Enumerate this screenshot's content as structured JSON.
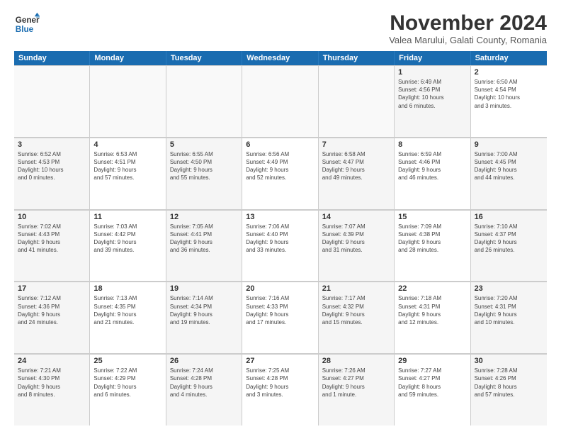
{
  "logo": {
    "line1": "General",
    "line2": "Blue"
  },
  "title": "November 2024",
  "location": "Valea Marului, Galati County, Romania",
  "headers": [
    "Sunday",
    "Monday",
    "Tuesday",
    "Wednesday",
    "Thursday",
    "Friday",
    "Saturday"
  ],
  "weeks": [
    [
      {
        "day": "",
        "info": "",
        "empty": true
      },
      {
        "day": "",
        "info": "",
        "empty": true
      },
      {
        "day": "",
        "info": "",
        "empty": true
      },
      {
        "day": "",
        "info": "",
        "empty": true
      },
      {
        "day": "",
        "info": "",
        "empty": true
      },
      {
        "day": "1",
        "info": "Sunrise: 6:49 AM\nSunset: 4:56 PM\nDaylight: 10 hours\nand 6 minutes.",
        "shaded": true
      },
      {
        "day": "2",
        "info": "Sunrise: 6:50 AM\nSunset: 4:54 PM\nDaylight: 10 hours\nand 3 minutes.",
        "shaded": false
      }
    ],
    [
      {
        "day": "3",
        "info": "Sunrise: 6:52 AM\nSunset: 4:53 PM\nDaylight: 10 hours\nand 0 minutes.",
        "shaded": true
      },
      {
        "day": "4",
        "info": "Sunrise: 6:53 AM\nSunset: 4:51 PM\nDaylight: 9 hours\nand 57 minutes.",
        "shaded": false
      },
      {
        "day": "5",
        "info": "Sunrise: 6:55 AM\nSunset: 4:50 PM\nDaylight: 9 hours\nand 55 minutes.",
        "shaded": true
      },
      {
        "day": "6",
        "info": "Sunrise: 6:56 AM\nSunset: 4:49 PM\nDaylight: 9 hours\nand 52 minutes.",
        "shaded": false
      },
      {
        "day": "7",
        "info": "Sunrise: 6:58 AM\nSunset: 4:47 PM\nDaylight: 9 hours\nand 49 minutes.",
        "shaded": true
      },
      {
        "day": "8",
        "info": "Sunrise: 6:59 AM\nSunset: 4:46 PM\nDaylight: 9 hours\nand 46 minutes.",
        "shaded": false
      },
      {
        "day": "9",
        "info": "Sunrise: 7:00 AM\nSunset: 4:45 PM\nDaylight: 9 hours\nand 44 minutes.",
        "shaded": true
      }
    ],
    [
      {
        "day": "10",
        "info": "Sunrise: 7:02 AM\nSunset: 4:43 PM\nDaylight: 9 hours\nand 41 minutes.",
        "shaded": true
      },
      {
        "day": "11",
        "info": "Sunrise: 7:03 AM\nSunset: 4:42 PM\nDaylight: 9 hours\nand 39 minutes.",
        "shaded": false
      },
      {
        "day": "12",
        "info": "Sunrise: 7:05 AM\nSunset: 4:41 PM\nDaylight: 9 hours\nand 36 minutes.",
        "shaded": true
      },
      {
        "day": "13",
        "info": "Sunrise: 7:06 AM\nSunset: 4:40 PM\nDaylight: 9 hours\nand 33 minutes.",
        "shaded": false
      },
      {
        "day": "14",
        "info": "Sunrise: 7:07 AM\nSunset: 4:39 PM\nDaylight: 9 hours\nand 31 minutes.",
        "shaded": true
      },
      {
        "day": "15",
        "info": "Sunrise: 7:09 AM\nSunset: 4:38 PM\nDaylight: 9 hours\nand 28 minutes.",
        "shaded": false
      },
      {
        "day": "16",
        "info": "Sunrise: 7:10 AM\nSunset: 4:37 PM\nDaylight: 9 hours\nand 26 minutes.",
        "shaded": true
      }
    ],
    [
      {
        "day": "17",
        "info": "Sunrise: 7:12 AM\nSunset: 4:36 PM\nDaylight: 9 hours\nand 24 minutes.",
        "shaded": true
      },
      {
        "day": "18",
        "info": "Sunrise: 7:13 AM\nSunset: 4:35 PM\nDaylight: 9 hours\nand 21 minutes.",
        "shaded": false
      },
      {
        "day": "19",
        "info": "Sunrise: 7:14 AM\nSunset: 4:34 PM\nDaylight: 9 hours\nand 19 minutes.",
        "shaded": true
      },
      {
        "day": "20",
        "info": "Sunrise: 7:16 AM\nSunset: 4:33 PM\nDaylight: 9 hours\nand 17 minutes.",
        "shaded": false
      },
      {
        "day": "21",
        "info": "Sunrise: 7:17 AM\nSunset: 4:32 PM\nDaylight: 9 hours\nand 15 minutes.",
        "shaded": true
      },
      {
        "day": "22",
        "info": "Sunrise: 7:18 AM\nSunset: 4:31 PM\nDaylight: 9 hours\nand 12 minutes.",
        "shaded": false
      },
      {
        "day": "23",
        "info": "Sunrise: 7:20 AM\nSunset: 4:31 PM\nDaylight: 9 hours\nand 10 minutes.",
        "shaded": true
      }
    ],
    [
      {
        "day": "24",
        "info": "Sunrise: 7:21 AM\nSunset: 4:30 PM\nDaylight: 9 hours\nand 8 minutes.",
        "shaded": true
      },
      {
        "day": "25",
        "info": "Sunrise: 7:22 AM\nSunset: 4:29 PM\nDaylight: 9 hours\nand 6 minutes.",
        "shaded": false
      },
      {
        "day": "26",
        "info": "Sunrise: 7:24 AM\nSunset: 4:28 PM\nDaylight: 9 hours\nand 4 minutes.",
        "shaded": true
      },
      {
        "day": "27",
        "info": "Sunrise: 7:25 AM\nSunset: 4:28 PM\nDaylight: 9 hours\nand 3 minutes.",
        "shaded": false
      },
      {
        "day": "28",
        "info": "Sunrise: 7:26 AM\nSunset: 4:27 PM\nDaylight: 9 hours\nand 1 minute.",
        "shaded": true
      },
      {
        "day": "29",
        "info": "Sunrise: 7:27 AM\nSunset: 4:27 PM\nDaylight: 8 hours\nand 59 minutes.",
        "shaded": false
      },
      {
        "day": "30",
        "info": "Sunrise: 7:28 AM\nSunset: 4:26 PM\nDaylight: 8 hours\nand 57 minutes.",
        "shaded": true
      }
    ]
  ]
}
